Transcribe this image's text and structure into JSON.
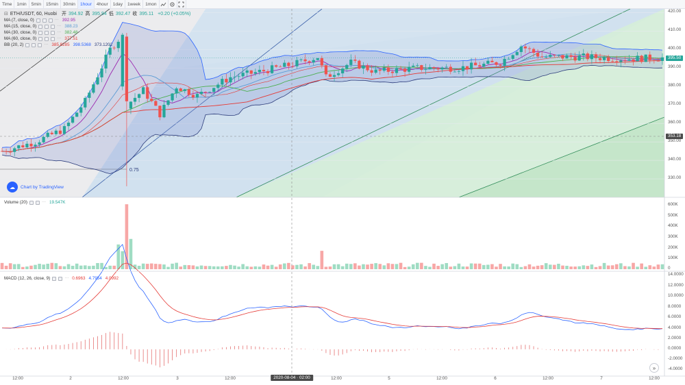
{
  "toolbar": {
    "intervals": [
      "Time",
      "1min",
      "5min",
      "15min",
      "30min",
      "1hour",
      "4hour",
      "1day",
      "1week",
      "1mon"
    ],
    "active": "1hour",
    "icons": [
      "indicator-icon",
      "settings-icon",
      "fullscreen-icon"
    ]
  },
  "header": {
    "symbol": "ETH/USDT, 60, Huobi",
    "open_label": "开",
    "open": "394.92",
    "high_label": "高",
    "high": "395.94",
    "low_label": "低",
    "low": "392.47",
    "close_label": "收",
    "close": "395.11",
    "change": "+0.20 (+0.05%)"
  },
  "indicators": [
    {
      "label": "MA (7, close, 0)",
      "value": "392.95",
      "color": "#9c27b0"
    },
    {
      "label": "MA (15, close, 0)",
      "value": "388.23",
      "color": "#5b9bd5"
    },
    {
      "label": "MA (30, close, 0)",
      "value": "382.48",
      "color": "#4caf50"
    },
    {
      "label": "MA (60, close, 0)",
      "value": "377.51",
      "color": "#e53935"
    }
  ],
  "bb": {
    "label": "BB (20, 2)",
    "basis": "385.8285",
    "upper": "398.5368",
    "lower": "373.1202"
  },
  "volume": {
    "label": "Volume (20)",
    "value": "19.547K"
  },
  "macd": {
    "label": "MACD (12, 26, close, 9)",
    "hist": "0.6963",
    "macd": "4.7954",
    "signal": "4.0992"
  },
  "fib_label": "0.75",
  "attribution": "Chart by TradingView",
  "price_axis": {
    "ticks": [
      "420.00",
      "410.00",
      "400.00",
      "390.00",
      "380.00",
      "370.00",
      "360.00",
      "350.00",
      "340.00",
      "330.00"
    ],
    "current_price": "395.50",
    "crosshair_price": "353.18"
  },
  "volume_axis": {
    "ticks": [
      "600K",
      "500K",
      "400K",
      "300K",
      "200K",
      "100K",
      "0"
    ]
  },
  "macd_axis": {
    "ticks": [
      "14.0000",
      "12.0000",
      "10.0000",
      "8.0000",
      "6.0000",
      "4.0000",
      "2.0000",
      "0.0000",
      "-2.0000",
      "-4.0000"
    ]
  },
  "time_axis": {
    "labels": [
      "12:00",
      "2",
      "12:00",
      "3",
      "12:00",
      "12:00",
      "5",
      "12:00",
      "6",
      "12:00",
      "7",
      "12:00"
    ],
    "crosshair_time": "2020-08-04 · 02:00"
  },
  "colors": {
    "up": "#26a69a",
    "down": "#ef5350",
    "vol_up": "#9fdcc3",
    "vol_down": "#f7a7a6"
  }
}
